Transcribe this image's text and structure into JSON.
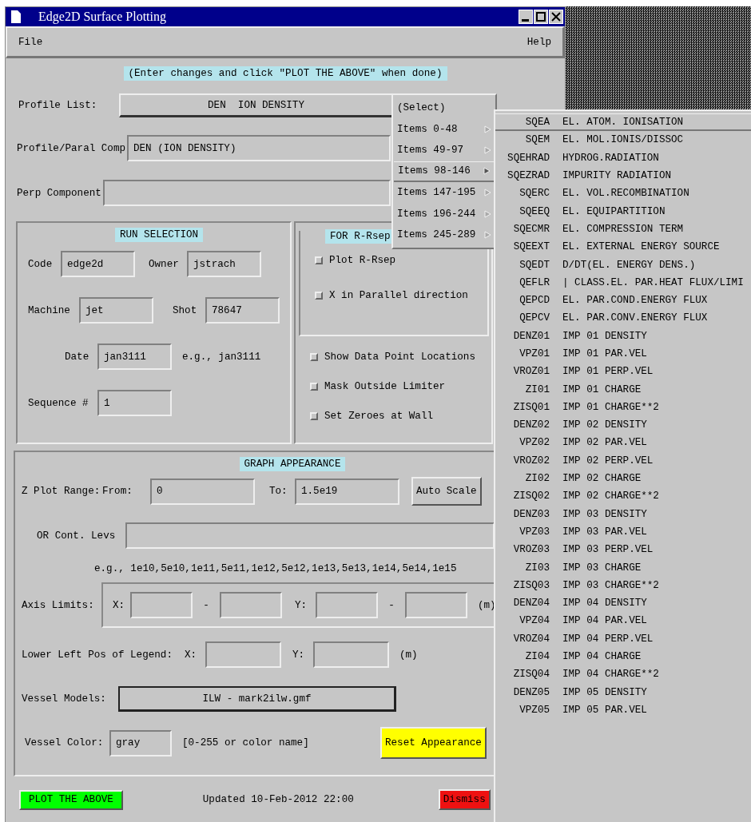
{
  "window": {
    "title": "Edge2D Surface Plotting"
  },
  "menubar": [
    {
      "label": "File"
    },
    {
      "label": "Help"
    }
  ],
  "hint": "(Enter changes and click \"PLOT THE ABOVE\" when done)",
  "profile_list": {
    "label": "Profile List:",
    "value": "DEN  ION DENSITY"
  },
  "profile_paral_comp": {
    "label": "Profile/Paral Comp",
    "value": "DEN (ION DENSITY)"
  },
  "perp_component": {
    "label": "Perp Component"
  },
  "run_selection": {
    "title": "RUN SELECTION",
    "code": {
      "label": "Code",
      "value": "edge2d"
    },
    "owner": {
      "label": "Owner",
      "value": "jstrach"
    },
    "machine": {
      "label": "Machine",
      "value": "jet"
    },
    "shot": {
      "label": "Shot",
      "value": "78647"
    },
    "date": {
      "label": "Date",
      "value": "jan3111"
    },
    "date_example": "e.g., jan3111",
    "sequence": {
      "label": "Sequence #",
      "value": "1"
    }
  },
  "rsep": {
    "title": "FOR R-Rsep",
    "options": [
      {
        "label": "Plot R-Rsep",
        "checked": false
      },
      {
        "label": "X in Parallel direction",
        "checked": false
      }
    ]
  },
  "options": [
    {
      "label": "Show Data Point Locations",
      "checked": false
    },
    {
      "label": "Mask Outside Limiter",
      "checked": false
    },
    {
      "label": "Set Zeroes at Wall",
      "checked": false
    }
  ],
  "graph_appearance": {
    "title": "GRAPH APPEARANCE",
    "z_plot_range": {
      "label": "Z Plot Range:",
      "from_label": "From:",
      "from_value": "0",
      "to_label": "To:",
      "to_value": "1.5e19",
      "auto_button": "Auto Scale"
    },
    "contour_levels": {
      "label": "OR Cont. Levs",
      "example": "e.g., 1e10,5e10,1e11,5e11,1e12,5e12,1e13,5e13,1e14,5e14,1e15"
    },
    "axis_limits": {
      "label": "Axis Limits:",
      "x_label": "X:",
      "y_label": "Y:",
      "separators": [
        "-",
        "-"
      ],
      "unit": "(m)"
    },
    "legend_position": {
      "label": "Lower Left Pos of Legend:",
      "x_label": "X:",
      "y_label": "Y:",
      "unit": "(m)"
    },
    "vessel_models": {
      "label": "Vessel Models:",
      "value": "ILW - mark2ilw.gmf"
    },
    "vessel_color": {
      "label": "Vessel Color:",
      "value": "gray",
      "hint": "[0-255 or color name]"
    },
    "reset_button": "Reset Appearance"
  },
  "footer": {
    "plot_button": "PLOT THE ABOVE",
    "updated": "Updated 10-Feb-2012 22:00",
    "dismiss_button": "Dismiss"
  },
  "profile_menu": [
    {
      "label": "(Select)",
      "cascade": false,
      "selected": false
    },
    {
      "label": "Items 0-48",
      "cascade": true,
      "selected": false
    },
    {
      "label": "Items 49-97",
      "cascade": true,
      "selected": false
    },
    {
      "label": "Items 98-146",
      "cascade": true,
      "selected": true
    },
    {
      "label": "Items 147-195",
      "cascade": true,
      "selected": false
    },
    {
      "label": "Items 196-244",
      "cascade": true,
      "selected": false
    },
    {
      "label": "Items 245-289",
      "cascade": true,
      "selected": false
    }
  ],
  "profile_submenu": [
    {
      "code": "SQEA",
      "description": "EL. ATOM. IONISATION",
      "selected": true
    },
    {
      "code": "SQEM",
      "description": "EL. MOL.IONIS/DISSOC",
      "selected": false
    },
    {
      "code": "SQEHRAD",
      "description": "HYDROG.RADIATION",
      "selected": false
    },
    {
      "code": "SQEZRAD",
      "description": "IMPURITY RADIATION",
      "selected": false
    },
    {
      "code": "SQERC",
      "description": "EL. VOL.RECOMBINATION",
      "selected": false
    },
    {
      "code": "SQEEQ",
      "description": "EL. EQUIPARTITION",
      "selected": false
    },
    {
      "code": "SQECMR",
      "description": "EL. COMPRESSION TERM",
      "selected": false
    },
    {
      "code": "SQEEXT",
      "description": "EL. EXTERNAL ENERGY SOURCE",
      "selected": false
    },
    {
      "code": "SQEDT",
      "description": "D/DT(EL. ENERGY DENS.)",
      "selected": false
    },
    {
      "code": "QEFLR",
      "description": "| CLASS.EL. PAR.HEAT FLUX/LIMI",
      "selected": false
    },
    {
      "code": "QEPCD",
      "description": "EL. PAR.COND.ENERGY FLUX",
      "selected": false
    },
    {
      "code": "QEPCV",
      "description": "EL. PAR.CONV.ENERGY FLUX",
      "selected": false
    },
    {
      "code": "DENZ01",
      "description": "IMP 01 DENSITY",
      "selected": false
    },
    {
      "code": "VPZ01",
      "description": "IMP 01 PAR.VEL",
      "selected": false
    },
    {
      "code": "VROZ01",
      "description": "IMP 01 PERP.VEL",
      "selected": false
    },
    {
      "code": "ZI01",
      "description": "IMP 01 CHARGE",
      "selected": false
    },
    {
      "code": "ZISQ01",
      "description": "IMP 01 CHARGE**2",
      "selected": false
    },
    {
      "code": "DENZ02",
      "description": "IMP 02 DENSITY",
      "selected": false
    },
    {
      "code": "VPZ02",
      "description": "IMP 02 PAR.VEL",
      "selected": false
    },
    {
      "code": "VROZ02",
      "description": "IMP 02 PERP.VEL",
      "selected": false
    },
    {
      "code": "ZI02",
      "description": "IMP 02 CHARGE",
      "selected": false
    },
    {
      "code": "ZISQ02",
      "description": "IMP 02 CHARGE**2",
      "selected": false
    },
    {
      "code": "DENZ03",
      "description": "IMP 03 DENSITY",
      "selected": false
    },
    {
      "code": "VPZ03",
      "description": "IMP 03 PAR.VEL",
      "selected": false
    },
    {
      "code": "VROZ03",
      "description": "IMP 03 PERP.VEL",
      "selected": false
    },
    {
      "code": "ZI03",
      "description": "IMP 03 CHARGE",
      "selected": false
    },
    {
      "code": "ZISQ03",
      "description": "IMP 03 CHARGE**2",
      "selected": false
    },
    {
      "code": "DENZ04",
      "description": "IMP 04 DENSITY",
      "selected": false
    },
    {
      "code": "VPZ04",
      "description": "IMP 04 PAR.VEL",
      "selected": false
    },
    {
      "code": "VROZ04",
      "description": "IMP 04 PERP.VEL",
      "selected": false
    },
    {
      "code": "ZI04",
      "description": "IMP 04 CHARGE",
      "selected": false
    },
    {
      "code": "ZISQ04",
      "description": "IMP 04 CHARGE**2",
      "selected": false
    },
    {
      "code": "DENZ05",
      "description": "IMP 05 DENSITY",
      "selected": false
    },
    {
      "code": "VPZ05",
      "description": "IMP 05 PAR.VEL",
      "selected": false
    }
  ]
}
